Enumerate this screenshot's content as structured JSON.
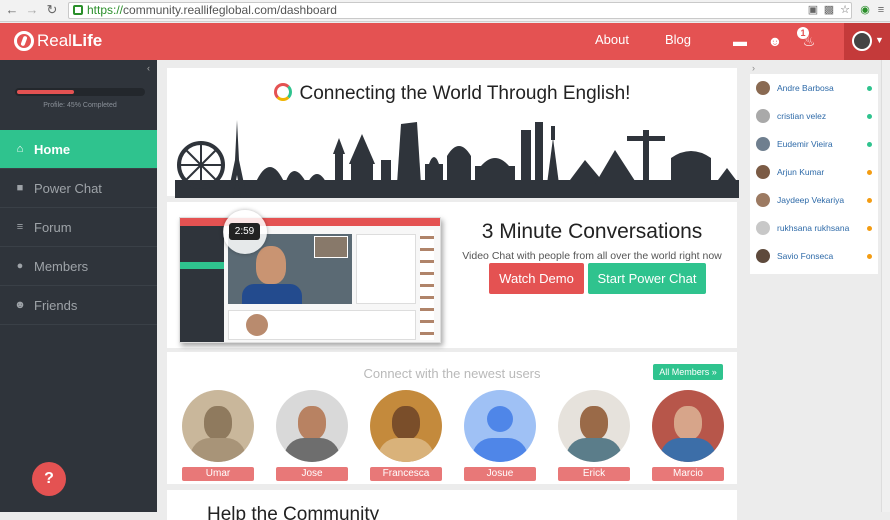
{
  "browser": {
    "url_scheme": "https://",
    "url_rest": "community.reallifeglobal.com/dashboard"
  },
  "header": {
    "logo_prefix": "Real",
    "logo_bold": "Life",
    "nav": [
      "About",
      "Blog"
    ],
    "notification_count": "1",
    "accent": "#e45252"
  },
  "sidebar": {
    "profile_progress": 0.45,
    "profile_label": "Profile: 45% Completed",
    "items": [
      {
        "label": "Home",
        "icon": "home-icon",
        "active": true
      },
      {
        "label": "Power Chat",
        "icon": "video-camera-icon",
        "active": false
      },
      {
        "label": "Forum",
        "icon": "list-icon",
        "active": false
      },
      {
        "label": "Members",
        "icon": "user-icon",
        "active": false
      },
      {
        "label": "Friends",
        "icon": "users-icon",
        "active": false
      }
    ],
    "help_icon": "help-chat-icon"
  },
  "hero": {
    "title": "Connecting the World Through English!"
  },
  "cta": {
    "timer": "2:59",
    "title": "3 Minute Conversations",
    "subtitle": "Video Chat with people from all over the world right now",
    "watch_demo": "Watch Demo",
    "start_power_chat": "Start Power Chat"
  },
  "new_users": {
    "heading": "Connect with the newest users",
    "all_members": "All Members »",
    "users": [
      {
        "name": "Umar"
      },
      {
        "name": "Jose"
      },
      {
        "name": "Francesca"
      },
      {
        "name": "Josue"
      },
      {
        "name": "Erick"
      },
      {
        "name": "Marcio"
      }
    ]
  },
  "bottom": {
    "title": "Help the Community"
  },
  "online_users": [
    {
      "name": "Andre Barbosa",
      "status": "#2fc38e"
    },
    {
      "name": "cristian velez",
      "status": "#2fc38e"
    },
    {
      "name": "Eudemir Vieira",
      "status": "#2fc38e"
    },
    {
      "name": "Arjun Kumar",
      "status": "#f39c12"
    },
    {
      "name": "Jaydeep Vekariya",
      "status": "#f39c12"
    },
    {
      "name": "rukhsana rukhsana",
      "status": "#f39c12"
    },
    {
      "name": "Savio Fonseca",
      "status": "#f39c12"
    }
  ]
}
